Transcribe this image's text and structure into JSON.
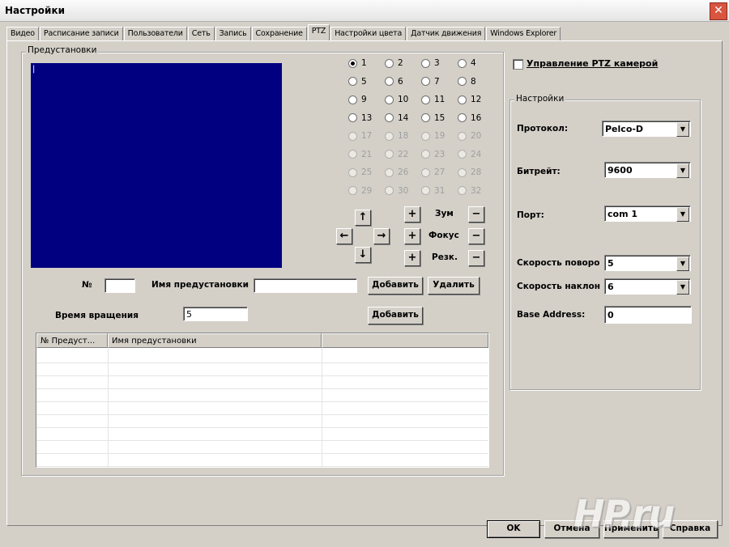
{
  "window": {
    "title": "Настройки",
    "close_glyph": "✕"
  },
  "tabs": [
    {
      "label": "Видео"
    },
    {
      "label": "Расписание записи"
    },
    {
      "label": "Пользователи"
    },
    {
      "label": "Сеть"
    },
    {
      "label": "Запись"
    },
    {
      "label": "Сохранение"
    },
    {
      "label": "PTZ",
      "active": true
    },
    {
      "label": "Настройки цвета"
    },
    {
      "label": "Датчик движения"
    },
    {
      "label": "Windows Explorer"
    }
  ],
  "presets": {
    "legend": "Предустановки",
    "preview_cursor": "|",
    "radios": [
      "1",
      "2",
      "3",
      "4",
      "5",
      "6",
      "7",
      "8",
      "9",
      "10",
      "11",
      "12",
      "13",
      "14",
      "15",
      "16",
      "17",
      "18",
      "19",
      "20",
      "21",
      "22",
      "23",
      "24",
      "25",
      "26",
      "27",
      "28",
      "29",
      "30",
      "31",
      "32"
    ],
    "selected": "1",
    "enabled_count": 16,
    "arrows": {
      "up": "↑",
      "left": "←",
      "right": "→",
      "down": "↓"
    },
    "zoom_label": "Зум",
    "focus_label": "Фокус",
    "iris_label": "Резк.",
    "plus": "+",
    "minus": "−",
    "number_label": "№",
    "number_value": "",
    "name_label": "Имя предустановки",
    "name_value": "",
    "add_button": "Добавить",
    "delete_button": "Удалить",
    "rotation_label": "Время вращения",
    "rotation_value": "5",
    "add_button2": "Добавить",
    "table_headers": [
      "№ Предуст...",
      "Имя предустановки",
      ""
    ]
  },
  "ptz": {
    "control_label": "Управление PTZ камерой",
    "control_checked": false,
    "settings_legend": "Настройки",
    "protocol_label": "Протокол:",
    "protocol_value": "Pelco-D",
    "baud_label": "Битрейт:",
    "baud_value": "9600",
    "port_label": "Порт:",
    "port_value": "com 1",
    "pan_speed_label": "Скорость поворо",
    "pan_speed_value": "5",
    "tilt_speed_label": "Скорость наклон",
    "tilt_speed_value": "6",
    "base_address_label": "Base Address:",
    "base_address_value": "0",
    "dropdown_arrow": "▼"
  },
  "footer": {
    "ok": "OK",
    "cancel": "Отмена",
    "apply": "Применить",
    "help": "Справка",
    "watermark": "HP.ru"
  }
}
